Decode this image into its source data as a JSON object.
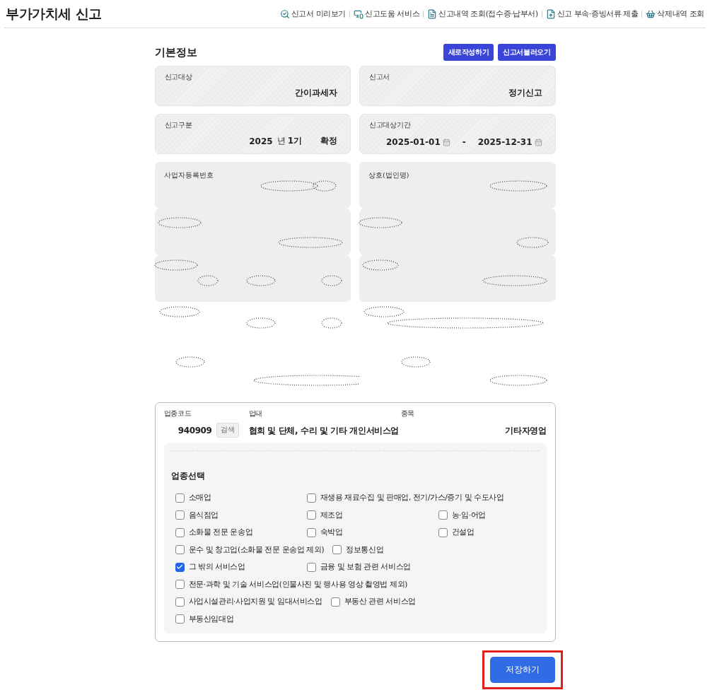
{
  "page_title": "부가가치세 신고",
  "header_links": [
    {
      "label": "신고서 미리보기"
    },
    {
      "label": "신고도움 서비스"
    },
    {
      "label": "신고내역 조회(접수증·납부서)"
    },
    {
      "label": "신고 부속·증빙서류 제출"
    },
    {
      "label": "삭제내역 조회"
    }
  ],
  "section_title": "기본정보",
  "action_buttons": [
    "새로작성하기",
    "신고서불러오기"
  ],
  "fields": [
    {
      "kind": "text",
      "label": "신고대상",
      "value": "간이과세자"
    },
    {
      "kind": "text",
      "label": "신고서",
      "value": "정기신고"
    },
    {
      "kind": "period",
      "label": "신고구분",
      "year": "2025",
      "year_unit": "년",
      "term": "1기",
      "status": "확정"
    },
    {
      "kind": "dates",
      "label": "신고대상기간",
      "start": "2025-01-01",
      "separator": "-",
      "end": "2025-12-31"
    }
  ],
  "redacted_fields": [
    {
      "label": "사업자등록번호"
    },
    {
      "label": "상호(법인명)"
    }
  ],
  "industry": {
    "code_label": "업종코드",
    "code": "940909",
    "search_button": "검색",
    "type_label": "업태",
    "type": "협회 및 단체, 수리 및 기타 개인서비스업",
    "item_label": "종목",
    "item": "기타자영업",
    "select_title": "업종선택",
    "rows": [
      [
        {
          "label": "소매업",
          "checked": false
        },
        {
          "label": "재생용 재료수집 및 판매업, 전기/가스/증기 및 수도사업",
          "checked": false
        }
      ],
      [
        {
          "label": "음식점업",
          "checked": false
        },
        {
          "label": "제조업",
          "checked": false
        },
        {
          "label": "농·임·어업",
          "checked": false
        }
      ],
      [
        {
          "label": "소화물 전문 운송업",
          "checked": false
        },
        {
          "label": "숙박업",
          "checked": false
        },
        {
          "label": "건설업",
          "checked": false
        }
      ],
      [
        {
          "label": "운수 및 창고업(소화물 전문 운송업 제외)",
          "checked": false
        },
        {
          "label": "정보통신업",
          "checked": false
        }
      ],
      [
        {
          "label": "그 밖의 서비스업",
          "checked": true
        },
        {
          "label": "금융 및 보험 관련 서비스업",
          "checked": false
        }
      ],
      [
        {
          "label": "전문·과학 및 기술 서비스업(인물사진 및 행사용 영상 촬영법 제외)",
          "checked": false
        }
      ],
      [
        {
          "label": "사업시설관리·사업지원 및 임대서비스업",
          "checked": false
        },
        {
          "label": "부동산 관련 서비스업",
          "checked": false
        }
      ],
      [
        {
          "label": "부동산임대업",
          "checked": false
        }
      ]
    ]
  },
  "save_button": "저장하기"
}
